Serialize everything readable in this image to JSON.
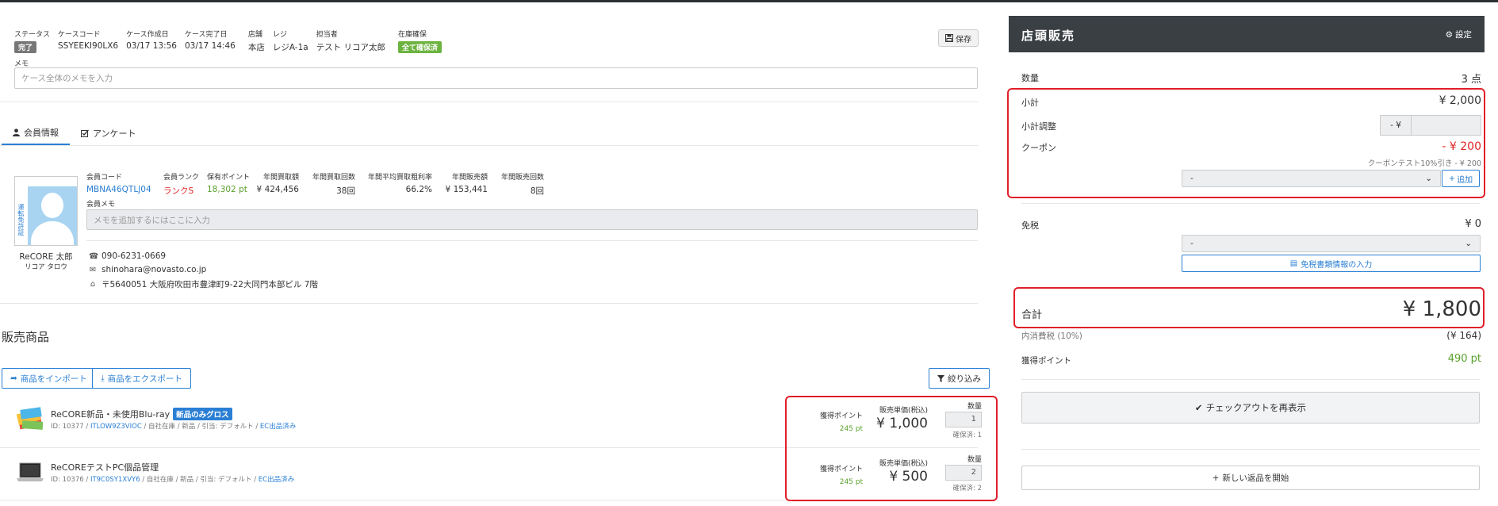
{
  "case": {
    "status_label": "ステータス",
    "status_value": "完了",
    "code_label": "ケースコード",
    "code_value": "SSYEEKI90LX6",
    "created_label": "ケース作成日",
    "created_value": "03/17 13:56",
    "completed_label": "ケース完了日",
    "completed_value": "03/17 14:46",
    "store_label": "店舗",
    "store_value": "本店",
    "register_label": "レジ",
    "register_value": "レジA-1a",
    "staff_label": "担当者",
    "staff_value": "テスト リコア太郎",
    "stock_label": "在庫確保",
    "stock_value": "全て確保済",
    "save_label": "保存",
    "memo_label": "メモ",
    "memo_placeholder": "ケース全体のメモを入力"
  },
  "tabs": [
    {
      "label": "会員情報",
      "icon": "user-icon",
      "active": true
    },
    {
      "label": "アンケート",
      "icon": "checkbox-icon",
      "active": false
    }
  ],
  "member": {
    "license_tag": "運転免許証",
    "name": "ReCORE 太郎",
    "kana": "リコア タロウ",
    "code_label": "会員コード",
    "code_value": "MBNA46QTLJ04",
    "rank_label": "会員ランク",
    "rank_value": "ランクS",
    "points_label": "保有ポイント",
    "points_value": "18,302 pt",
    "buy_amount_label": "年間買取額",
    "buy_amount_value": "¥ 424,456",
    "buy_count_label": "年間買取回数",
    "buy_count_value": "38回",
    "margin_label": "年間平均買取粗利率",
    "margin_value": "66.2%",
    "sales_amount_label": "年間販売額",
    "sales_amount_value": "¥ 153,441",
    "sales_count_label": "年間販売回数",
    "sales_count_value": "8回",
    "memo_label": "会員メモ",
    "memo_placeholder": "メモを追加するにはここに入力",
    "phone": "090-6231-0669",
    "email": "shinohara@novasto.co.jp",
    "address": "〒5640051 大阪府吹田市豊津町9-22大同門本部ビル 7階"
  },
  "products_section": {
    "title": "販売商品",
    "import_label": "商品をインポート",
    "export_label": "商品をエクスポート",
    "filter_label": "絞り込み",
    "items": [
      {
        "name": "ReCORE新品・未使用Blu-ray",
        "badge": "新品のみグロス",
        "id_prefix": "ID: 10377 / ",
        "code": "ITLOW9Z3VIOC",
        "meta": " / 自社在庫 / 新品 / 引当: デフォルト / ",
        "ec": "EC出品済み",
        "points_label": "獲得ポイント",
        "points_value": "245 pt",
        "price_label": "販売単価(税込)",
        "price_value": "¥ 1,000",
        "qty_label": "数量",
        "qty_value": "1",
        "reserved": "確保済: 1"
      },
      {
        "name": "ReCOREテストPC個品管理",
        "badge": "",
        "id_prefix": "ID: 10376 / ",
        "code": "IT9C0SY1XVY6",
        "meta": " / 自社在庫 / 新品 / 引当: デフォルト / ",
        "ec": "EC出品済み",
        "points_label": "獲得ポイント",
        "points_value": "245 pt",
        "price_label": "販売単価(税込)",
        "price_value": "¥ 500",
        "qty_label": "数量",
        "qty_value": "2",
        "reserved": "確保済: 2"
      }
    ]
  },
  "panel": {
    "title": "店頭販売",
    "settings_label": "設定",
    "quantity_label": "数量",
    "quantity_value": "3 点",
    "subtotal_label": "小計",
    "subtotal_value": "¥ 2,000",
    "adjust_label": "小計調整",
    "adjust_prefix": "- ¥",
    "coupon_label": "クーポン",
    "coupon_value": "- ¥ 200",
    "coupon_detail": "クーポンテスト10%引き - ¥ 200",
    "coupon_select": "-",
    "add_label": "追加",
    "taxfree_label": "免税",
    "taxfree_value": "¥ 0",
    "taxfree_select": "-",
    "taxfree_doc_label": "免税書類情報の入力",
    "total_label": "合計",
    "total_value": "¥ 1,800",
    "tax_label": "内消費税 (10%)",
    "tax_value": "(¥ 164)",
    "earn_label": "獲得ポイント",
    "earn_value": "490 pt",
    "checkout_label": "チェックアウトを再表示",
    "new_return_label": "新しい返品を開始"
  },
  "colors": {
    "accent": "#2a7fd4",
    "highlight": "#e01f2a",
    "panel_header": "#3a3f44",
    "positive": "#5aa02c"
  }
}
